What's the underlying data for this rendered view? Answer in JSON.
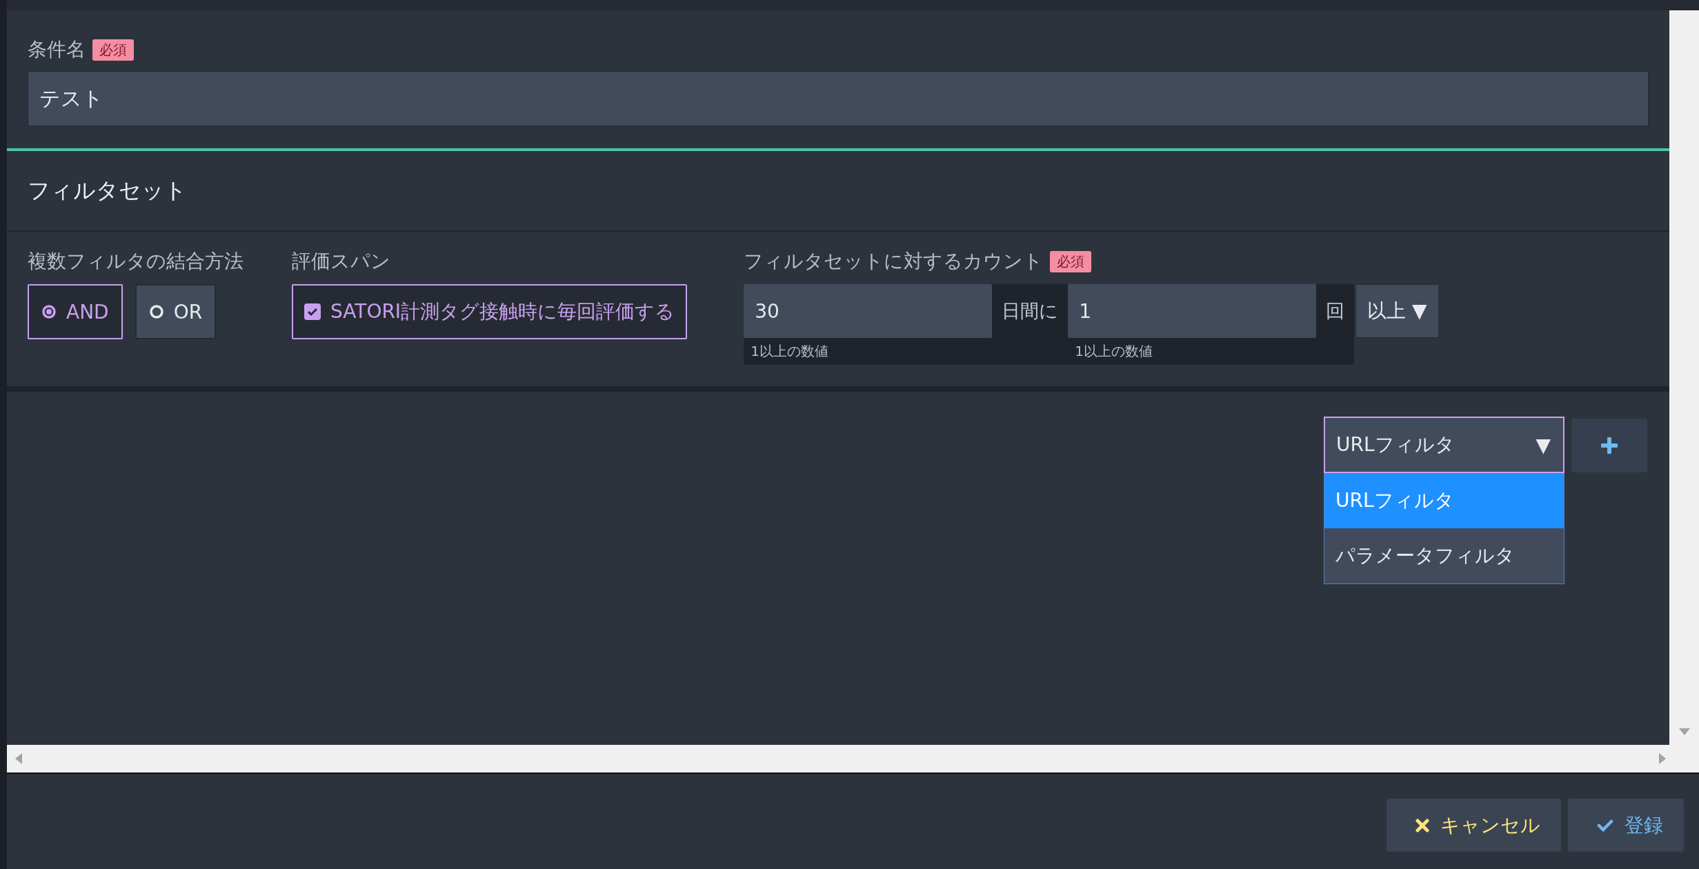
{
  "condition_name": {
    "label": "条件名",
    "required_badge": "必須",
    "value": "テスト"
  },
  "filter_set": {
    "title": "フィルタセット",
    "combine": {
      "label": "複数フィルタの結合方法",
      "options": [
        {
          "label": "AND",
          "selected": true
        },
        {
          "label": "OR",
          "selected": false
        }
      ]
    },
    "span": {
      "label": "評価スパン",
      "checkbox": {
        "label": "SATORI計測タグ接触時に毎回評価する",
        "checked": true
      }
    },
    "count": {
      "label": "フィルタセットに対するカウント",
      "required_badge": "必須",
      "days": {
        "value": "30",
        "hint": "1以上の数値"
      },
      "days_suffix": "日間に",
      "times": {
        "value": "1",
        "hint": "1以上の数値"
      },
      "times_suffix": "回",
      "comparator": {
        "value": "以上",
        "caret": "▼"
      }
    }
  },
  "filter_type": {
    "value": "URLフィルタ",
    "caret": "▼",
    "expanded": true,
    "options": [
      {
        "label": "URLフィルタ",
        "selected": true
      },
      {
        "label": "パラメータフィルタ",
        "selected": false
      }
    ]
  },
  "footer": {
    "buttons": [
      {
        "label": "キャンセル",
        "kind": "cancel"
      },
      {
        "label": "登録",
        "kind": "submit"
      }
    ]
  }
}
